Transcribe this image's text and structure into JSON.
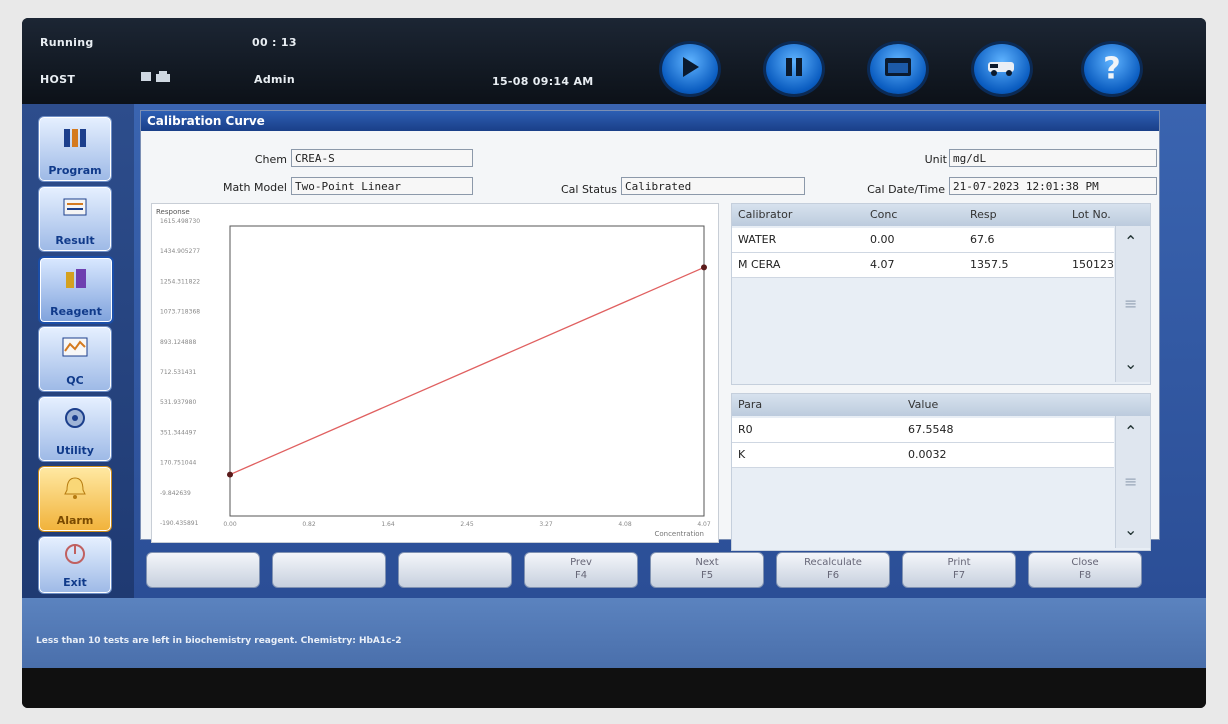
{
  "topbar": {
    "status": "Running",
    "timer": "00 : 13",
    "host": "HOST",
    "user": "Admin",
    "datetime": "15-08 09:14 AM",
    "buttons": [
      {
        "icon": "play-icon"
      },
      {
        "icon": "pause-icon"
      },
      {
        "icon": "stop-icon"
      },
      {
        "icon": "ambulance-icon"
      },
      {
        "icon": "help-icon",
        "glyph": "?"
      }
    ]
  },
  "sidebar": {
    "items": [
      {
        "label": "Program",
        "icon": "program-icon"
      },
      {
        "label": "Result",
        "icon": "result-icon"
      },
      {
        "label": "Reagent",
        "icon": "reagent-icon",
        "active": true
      },
      {
        "label": "QC",
        "icon": "qc-icon"
      },
      {
        "label": "Utility",
        "icon": "utility-icon"
      },
      {
        "label": "Alarm",
        "icon": "alarm-icon"
      },
      {
        "label": "Exit",
        "icon": "exit-icon"
      }
    ]
  },
  "panel": {
    "title": "Calibration Curve",
    "chem_label": "Chem",
    "chem_value": "CREA-S",
    "unit_label": "Unit",
    "unit_value": "mg/dL",
    "math_model_label": "Math Model",
    "math_model_value": "Two-Point Linear",
    "cal_status_label": "Cal Status",
    "cal_status_value": "Calibrated",
    "cal_datetime_label": "Cal Date/Time",
    "cal_datetime_value": "21-07-2023 12:01:38 PM"
  },
  "chart_data": {
    "type": "line",
    "ylabel": "Response",
    "xlabel": "Concentration",
    "y_ticks": [
      "1615.498730",
      "1434.905277",
      "1254.311822",
      "1073.718368",
      "893.124888",
      "712.531431",
      "531.937980",
      "351.344497",
      "170.751044",
      "-9.842639",
      "-190.435891"
    ],
    "x_ticks": [
      "0.00",
      "0.82",
      "1.64",
      "2.45",
      "3.27",
      "4.08",
      "4.07"
    ],
    "ylim": [
      -190.435891,
      1615.49873
    ],
    "xlim": [
      0,
      4.07
    ],
    "series": [
      {
        "color": "#e06060",
        "points": [
          [
            0.0,
            67.6
          ],
          [
            4.07,
            1357.5
          ]
        ]
      }
    ]
  },
  "calibrator_table": {
    "headers": [
      "Calibrator",
      "Conc",
      "Resp",
      "Lot No."
    ],
    "rows": [
      [
        "WATER",
        "0.00",
        "67.6",
        ""
      ],
      [
        "M CERA",
        "4.07",
        "1357.5",
        "150123"
      ]
    ]
  },
  "param_table": {
    "headers": [
      "Para",
      "Value"
    ],
    "rows": [
      [
        "R0",
        "67.5548"
      ],
      [
        "K",
        "0.0032"
      ]
    ]
  },
  "function_buttons": [
    {
      "line1": "",
      "line2": ""
    },
    {
      "line1": "",
      "line2": ""
    },
    {
      "line1": "",
      "line2": ""
    },
    {
      "line1": "Prev",
      "line2": "F4"
    },
    {
      "line1": "Next",
      "line2": "F5"
    },
    {
      "line1": "Recalculate",
      "line2": "F6"
    },
    {
      "line1": "Print",
      "line2": "F7"
    },
    {
      "line1": "Close",
      "line2": "F8"
    }
  ],
  "status_message": "Less than 10 tests are left in biochemistry reagent. Chemistry: HbA1c-2"
}
